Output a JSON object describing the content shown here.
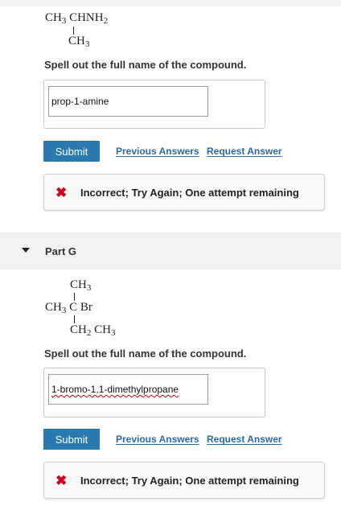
{
  "partF": {
    "structure": {
      "main_left": "CH",
      "main_left_sub": "3",
      "main_right": "CHNH",
      "main_right_sub": "2",
      "branch": "CH",
      "branch_sub": "3"
    },
    "prompt": "Spell out the full name of the compound.",
    "answer_value": "prop-1-amine",
    "submit_label": "Submit",
    "previous_answers_label": "Previous Answers",
    "request_answer_label": "Request Answer",
    "feedback_text": "Incorrect; Try Again; One attempt remaining"
  },
  "partG": {
    "header_label": "Part G",
    "structure": {
      "top": "CH",
      "top_sub": "3",
      "mid_left": "CH",
      "mid_left_sub": "3",
      "mid_c": "C",
      "mid_br": "Br",
      "bottom_a": "CH",
      "bottom_a_sub": "2",
      "bottom_b": "CH",
      "bottom_b_sub": "3"
    },
    "prompt": "Spell out the full name of the compound.",
    "answer_value": "1-bromo-1,1-dimethylpropane",
    "submit_label": "Submit",
    "previous_answers_label": "Previous Answers",
    "request_answer_label": "Request Answer",
    "feedback_text": "Incorrect; Try Again; One attempt remaining"
  },
  "colors": {
    "submit_button": "#2a7ab0",
    "link": "#2a6aa6",
    "error_icon": "#d0021b",
    "part_header_bg": "#f2f2f2"
  },
  "icons": {
    "feedback": "x-mark-icon",
    "part_toggle": "caret-down-icon"
  }
}
